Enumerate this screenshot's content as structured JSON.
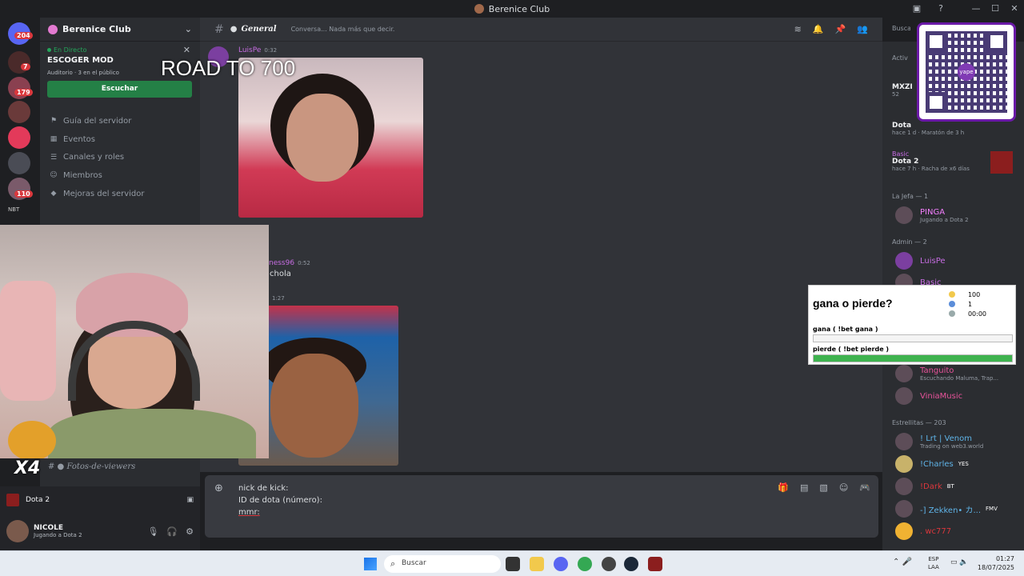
{
  "window": {
    "title": "Berenice Club"
  },
  "server_rail": {
    "home_badge": "204",
    "badges": [
      "7",
      "179",
      "110"
    ],
    "nbt_label": "NBT"
  },
  "sidebar": {
    "server_name": "Berenice Club",
    "live": {
      "status": "En Directo",
      "title": "ESCOGER MOD",
      "audience_channel": "Auditorio",
      "audience_count": "3 en el público",
      "listen_button": "Escuchar"
    },
    "nav": [
      {
        "label": "Guía del servidor",
        "icon": "signpost-icon"
      },
      {
        "label": "Eventos",
        "icon": "calendar-icon"
      },
      {
        "label": "Canales y roles",
        "icon": "list-icon"
      },
      {
        "label": "Miembros",
        "icon": "members-icon"
      },
      {
        "label": "Mejoras del servidor",
        "icon": "boost-icon"
      }
    ],
    "channel_below": "Fotos-de-viewers",
    "activity_game": "Dota 2",
    "user": {
      "name": "NICOLE",
      "status": "Jugando a Dota 2"
    }
  },
  "channel": {
    "name": "General",
    "topic": "Conversa... Nada más que decir.",
    "search_placeholder": "Buscar"
  },
  "messages": [
    {
      "author": "LuisPe",
      "time": "0:32"
    },
    {
      "author": "ness96",
      "time": "0:52",
      "text": "chola"
    },
    {
      "author": "",
      "time": "1:27"
    }
  ],
  "composer": {
    "lines": [
      "nick de kick:",
      "ID de dota (número):",
      "mmr:"
    ]
  },
  "members_panel": {
    "activity_header": "Activ",
    "activity_cards": [
      {
        "user": "MXZI",
        "sub": "52"
      },
      {
        "game": "Dota",
        "meta": "hace 1 d",
        "extra": "Maratón de 3 h"
      },
      {
        "user": "Basic",
        "game": "Dota 2",
        "meta": "hace 7 h",
        "extra": "Racha de x6 días"
      }
    ],
    "sections": [
      {
        "title": "La Jefa — 1"
      },
      {
        "title": "Admin — 2"
      },
      {
        "title": "Estrellitas — 203"
      }
    ],
    "members": [
      {
        "name": "PINGA",
        "status": "Jugando a Dota 2",
        "color": "#f47fff"
      },
      {
        "name": "LuisPe",
        "status": "",
        "color": "#c76de3"
      },
      {
        "name": "Basic",
        "status": "",
        "color": "#c76de3"
      },
      {
        "name": "Tanguito",
        "status": "Escuchando Maluma, Trap...",
        "color": "#e8539a"
      },
      {
        "name": "ViniaMusic",
        "status": "",
        "color": "#e8539a"
      },
      {
        "name": "! Lrt | Venom",
        "status": "Trading on web3.world",
        "color": "#5fb4e8"
      },
      {
        "name": "!Charles",
        "status": "",
        "color": "#5fb4e8",
        "tag": "YES"
      },
      {
        "name": "!Dark",
        "status": "",
        "color": "#da373c",
        "tag": "BT"
      },
      {
        "name": "-] Zekken• カ...",
        "status": "",
        "color": "#5fb4e8",
        "tag": "FMV"
      },
      {
        "name": ". wc777",
        "status": "",
        "color": "#da373c"
      }
    ]
  },
  "overlay": {
    "road_text": "ROAD TO 700",
    "multiplier": "X4",
    "qr_logo": "yape",
    "poll": {
      "question": "gana o pierde?",
      "coins": "100",
      "voters": "1",
      "timer": "00:00",
      "options": [
        {
          "label": "gana ( !bet gana )",
          "fraction": 0.0
        },
        {
          "label": "pierde ( !bet pierde )",
          "fraction": 1.0
        }
      ]
    }
  },
  "taskbar": {
    "search_placeholder": "Buscar",
    "lang_line1": "ESP",
    "lang_line2": "LAA",
    "time": "01:27",
    "date": "18/07/2025"
  }
}
